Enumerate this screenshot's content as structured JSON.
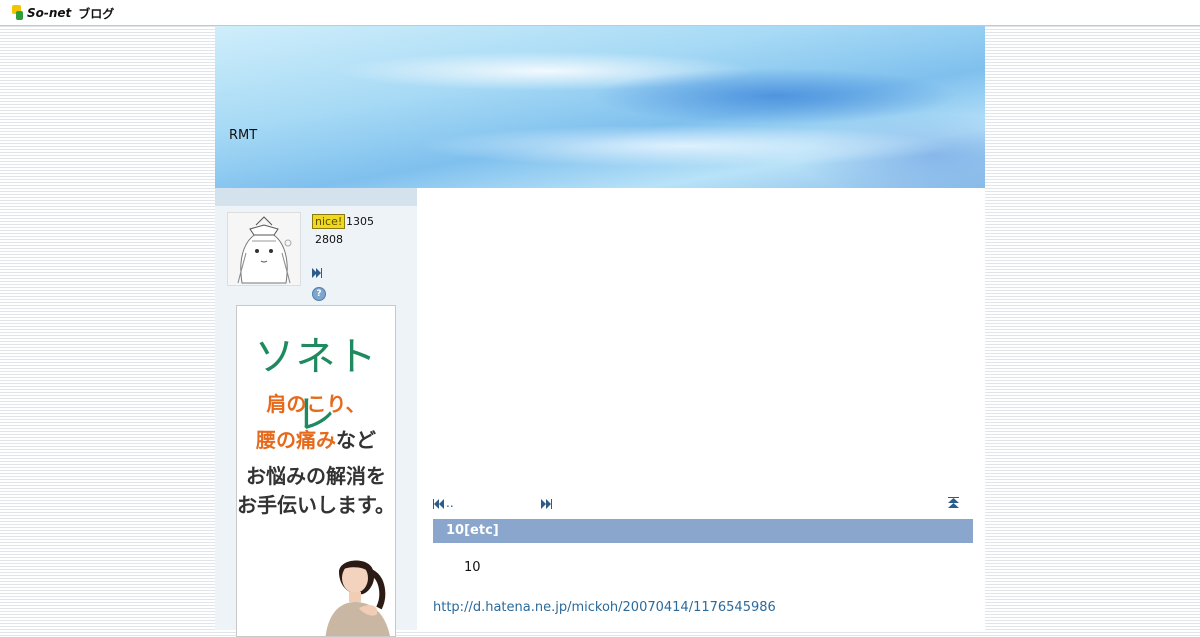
{
  "header": {
    "logo_text": "So-net",
    "logo_sub": "ブログ"
  },
  "blog": {
    "title": "RMT"
  },
  "sidebar": {
    "nice_label": "nice!",
    "nice_count": "1305",
    "visit_count": "2808",
    "help_label": "?"
  },
  "ad": {
    "brand": "ソネトレ",
    "line1_orange": "肩のこり、",
    "line2_orange": "腰の痛み",
    "line2_dark": "など",
    "line3": "お悩みの解消を",
    "line4": "お手伝いします。"
  },
  "post": {
    "prev_label": "..",
    "title": "10[etc]",
    "body": "10",
    "link": "http://d.hatena.ne.jp/mickoh/20070414/1176545986"
  },
  "colors": {
    "accent": "#8aa6cc",
    "link": "#2b6a9c",
    "nice": "#f0d820"
  }
}
